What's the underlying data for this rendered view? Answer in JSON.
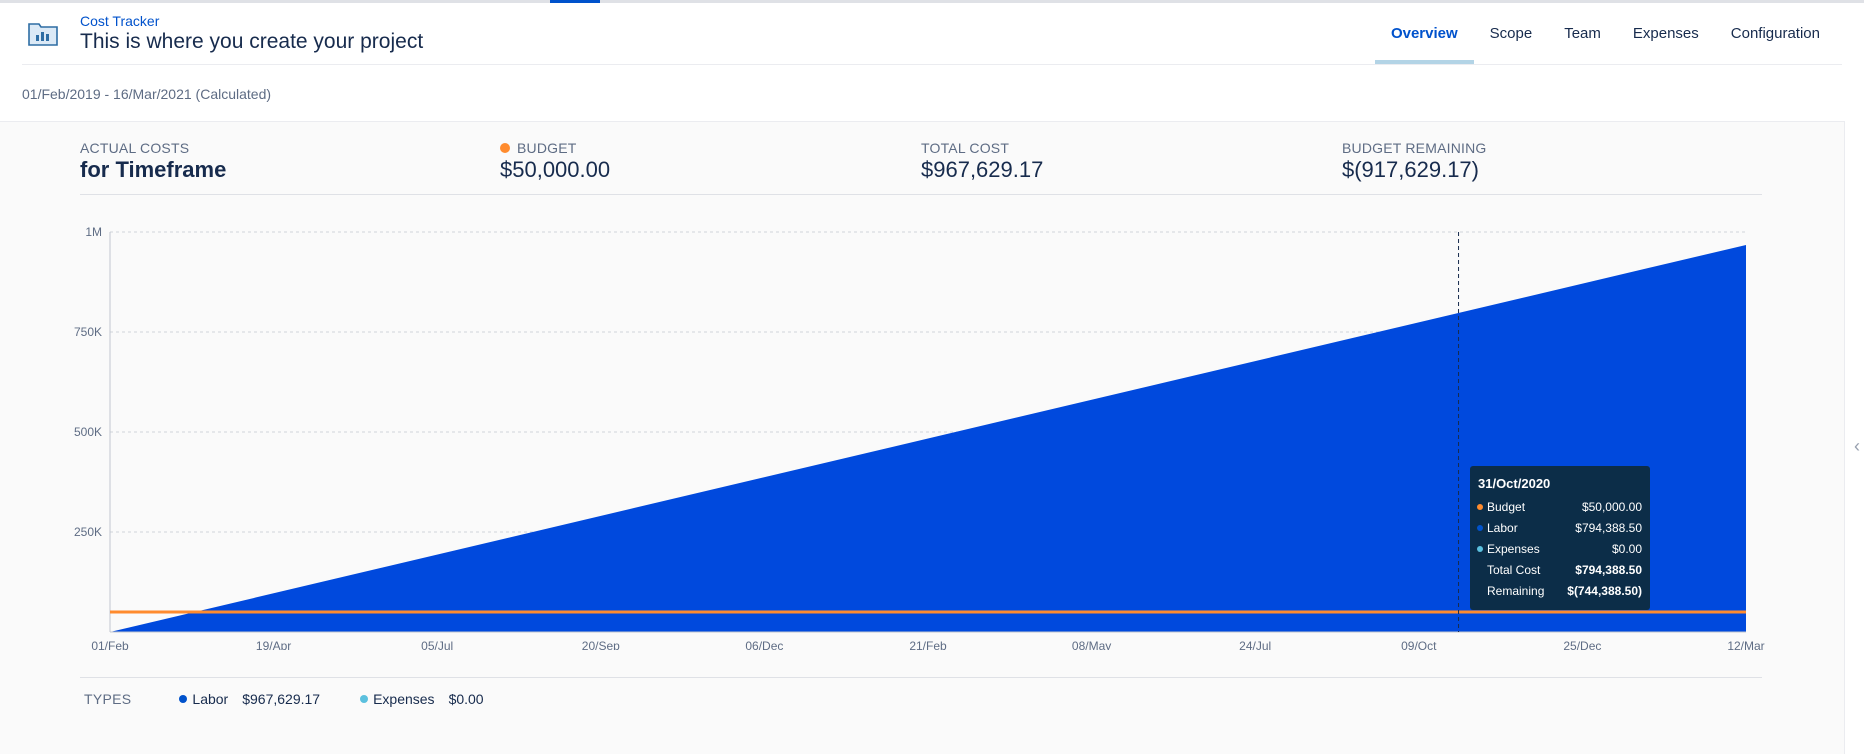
{
  "header": {
    "breadcrumb": "Cost Tracker",
    "title": "This is where you create your project",
    "icon": "folder-chart-icon"
  },
  "tabs": [
    {
      "label": "Overview",
      "active": true
    },
    {
      "label": "Scope",
      "active": false
    },
    {
      "label": "Team",
      "active": false
    },
    {
      "label": "Expenses",
      "active": false
    },
    {
      "label": "Configuration",
      "active": false
    }
  ],
  "date_range": "01/Feb/2019 - 16/Mar/2021 (Calculated)",
  "summary": {
    "actual_costs_label": "ACTUAL COSTS",
    "actual_costs_value": "for Timeframe",
    "budget_label": "BUDGET",
    "budget_value": "$50,000.00",
    "total_cost_label": "TOTAL COST",
    "total_cost_value": "$967,629.17",
    "remaining_label": "BUDGET REMAINING",
    "remaining_value": "$(917,629.17)"
  },
  "colors": {
    "labor": "#0052cc",
    "labor_fill": "#0049dd",
    "budget": "#ff8b2e",
    "expenses": "#5bc0de",
    "tooltip_bg": "#0c2d48"
  },
  "chart_data": {
    "type": "area",
    "y_ticks": [
      "1M",
      "750K",
      "500K",
      "250K"
    ],
    "ylim": [
      0,
      1000000
    ],
    "x_ticks": [
      "01/Feb",
      "19/Apr",
      "05/Jul",
      "20/Sep",
      "06/Dec",
      "21/Feb",
      "08/May",
      "24/Jul",
      "09/Oct",
      "25/Dec",
      "12/Mar"
    ],
    "xlim": [
      "2019-02-01",
      "2021-03-16"
    ],
    "grid": true,
    "series": [
      {
        "name": "Labor",
        "type": "area",
        "points": [
          [
            "2019-02-01",
            0
          ],
          [
            "2021-03-16",
            967629.17
          ]
        ]
      },
      {
        "name": "Budget",
        "type": "line",
        "points": [
          [
            "2019-02-01",
            50000
          ],
          [
            "2021-03-16",
            50000
          ]
        ]
      }
    ],
    "tooltip": {
      "date": "31/Oct/2020",
      "marker_date": "2020-10-31",
      "rows": [
        {
          "label": "Budget",
          "value": "$50,000.00",
          "dot": "#ff8b2e",
          "bold": false
        },
        {
          "label": "Labor",
          "value": "$794,388.50",
          "dot": "#0052cc",
          "bold": false
        },
        {
          "label": "Expenses",
          "value": "$0.00",
          "dot": "#5bc0de",
          "bold": false
        },
        {
          "label": "Total Cost",
          "value": "$794,388.50",
          "dot": "",
          "bold": true
        },
        {
          "label": "Remaining",
          "value": "$(744,388.50)",
          "dot": "",
          "bold": true
        }
      ]
    }
  },
  "types": {
    "label": "TYPES",
    "items": [
      {
        "name": "Labor",
        "value": "$967,629.17",
        "color": "#0052cc"
      },
      {
        "name": "Expenses",
        "value": "$0.00",
        "color": "#5bc0de"
      }
    ]
  }
}
